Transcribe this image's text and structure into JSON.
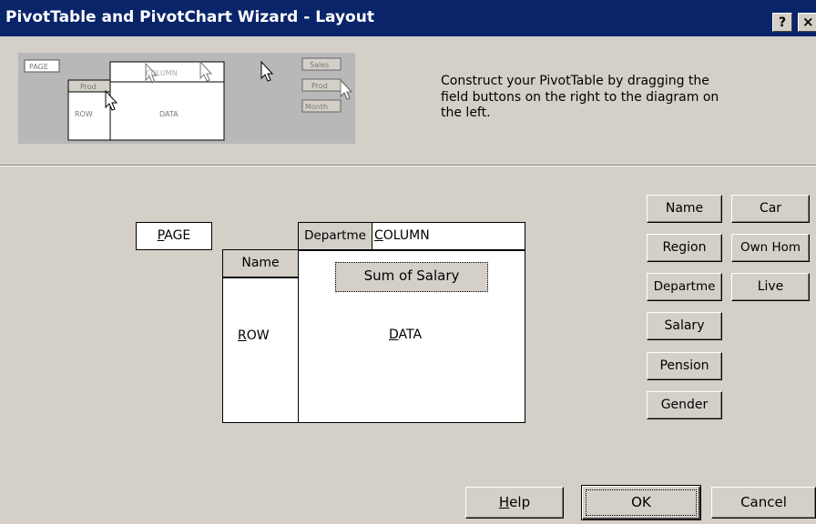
{
  "window": {
    "title": "PivotTable and PivotChart Wizard - Layout",
    "help_button": "?",
    "close_button": "×"
  },
  "preview": {
    "page": "PAGE",
    "column": "COLUMN",
    "row": "ROW",
    "data": "DATA",
    "field": "Prod",
    "buttons": [
      "Sales",
      "Prod",
      "Month"
    ]
  },
  "instructions": "Construct your PivotTable by dragging the field buttons on the right to the diagram on the left.",
  "layout": {
    "page": {
      "u": "P",
      "rest": "AGE"
    },
    "column": {
      "u": "C",
      "rest": "OLUMN"
    },
    "row": {
      "u": "R",
      "rest": "OW"
    },
    "data": {
      "u": "D",
      "rest": "ATA"
    },
    "column_field": "Departme",
    "row_field": "Name",
    "data_field": "Sum of Salary"
  },
  "field_buttons": {
    "name": "Name",
    "car": "Car",
    "region": "Region",
    "own_home": "Own Hom",
    "department": "Departme",
    "live": "Live",
    "salary": "Salary",
    "pension": "Pension",
    "gender": "Gender"
  },
  "dialog_buttons": {
    "help_u": "H",
    "help_rest": "elp",
    "ok": "OK",
    "cancel": "Cancel"
  }
}
